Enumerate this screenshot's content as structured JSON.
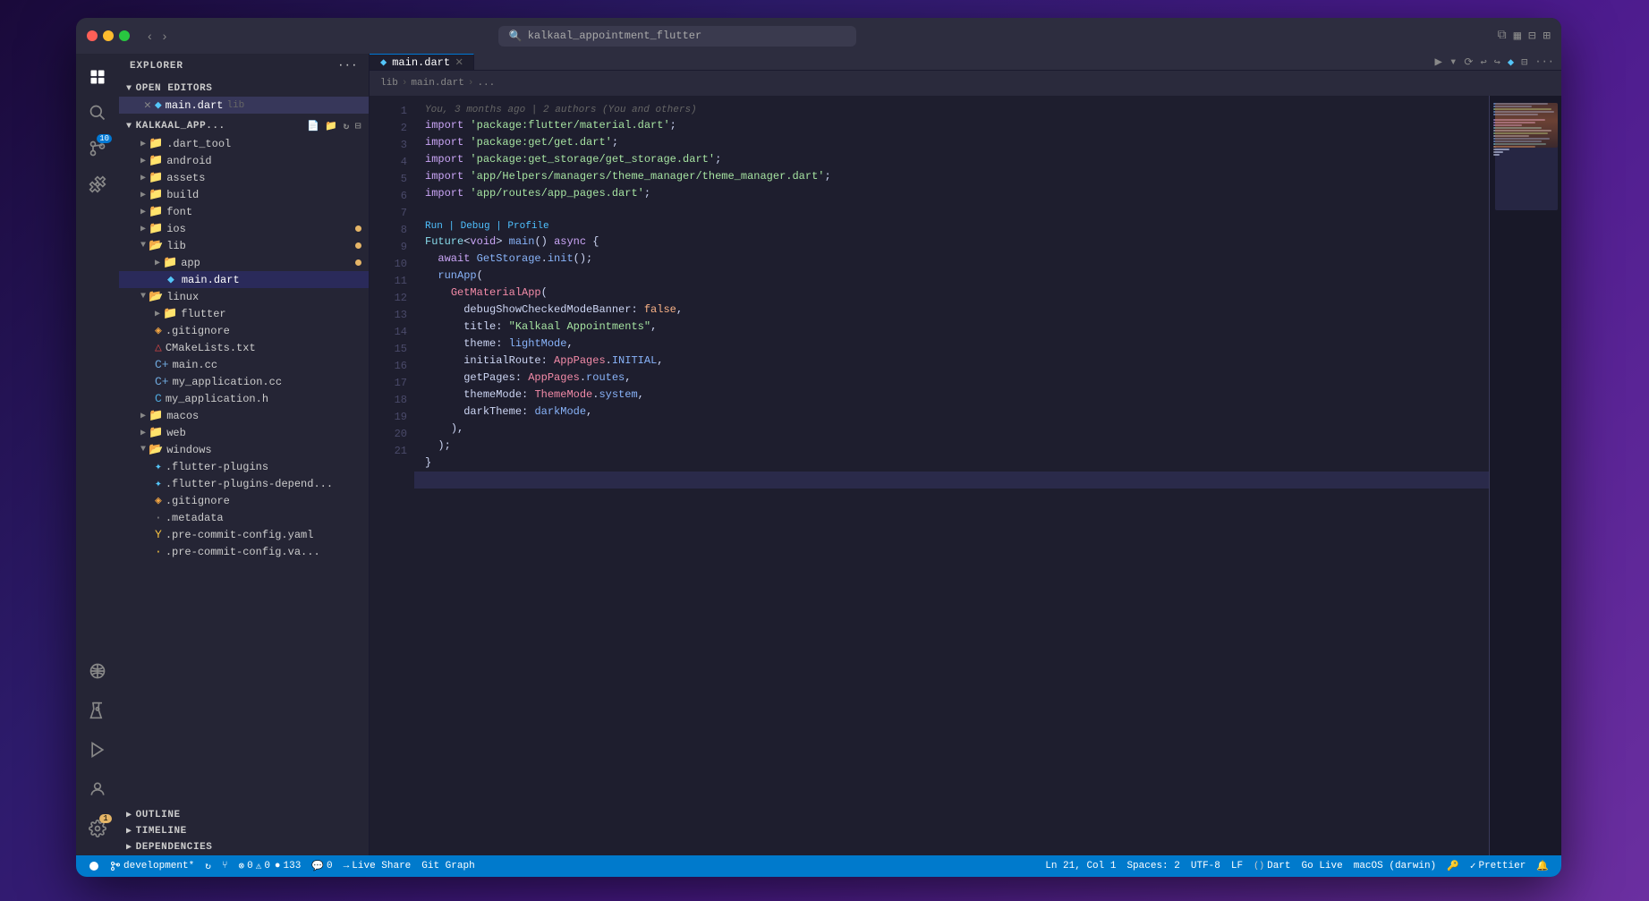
{
  "window": {
    "title": "kalkaal_appointment_flutter",
    "tab": "main.dart",
    "breadcrumb": [
      "lib",
      "main.dart",
      "..."
    ]
  },
  "editor": {
    "run_debug_label": "Run | Debug | Profile",
    "git_annotation": "You, 3 months ago | 2 authors (You and others)",
    "lines": [
      {
        "num": 1,
        "content": "import_flutter"
      },
      {
        "num": 2,
        "content": "import_get"
      },
      {
        "num": 3,
        "content": "import_get_storage"
      },
      {
        "num": 4,
        "content": "import_theme_manager"
      },
      {
        "num": 5,
        "content": "import_app_pages"
      },
      {
        "num": 6,
        "content": ""
      },
      {
        "num": 7,
        "content": "future_main"
      },
      {
        "num": 8,
        "content": "await_getstorage"
      },
      {
        "num": 9,
        "content": "run_app"
      },
      {
        "num": 10,
        "content": "get_material_app"
      },
      {
        "num": 11,
        "content": "debug_false"
      },
      {
        "num": 12,
        "content": "title"
      },
      {
        "num": 13,
        "content": "theme"
      },
      {
        "num": 14,
        "content": "initial_route"
      },
      {
        "num": 15,
        "content": "get_pages"
      },
      {
        "num": 16,
        "content": "theme_mode"
      },
      {
        "num": 17,
        "content": "dark_theme"
      },
      {
        "num": 18,
        "content": "close1"
      },
      {
        "num": 19,
        "content": "close2"
      },
      {
        "num": 20,
        "content": "close3"
      },
      {
        "num": 21,
        "content": ""
      }
    ]
  },
  "sidebar": {
    "explorer_label": "EXPLORER",
    "open_editors_label": "OPEN EDITORS",
    "project_label": "KALKAAL_APP...",
    "outline_label": "OUTLINE",
    "timeline_label": "TIMELINE",
    "dependencies_label": "DEPENDENCIES",
    "open_editor_item": "main.dart",
    "open_editor_path": "lib",
    "folders": [
      {
        "name": ".dart_tool",
        "type": "folder",
        "indent": 1
      },
      {
        "name": "android",
        "type": "folder",
        "indent": 1
      },
      {
        "name": "assets",
        "type": "folder",
        "indent": 1
      },
      {
        "name": "build",
        "type": "folder",
        "indent": 1
      },
      {
        "name": "font",
        "type": "folder",
        "indent": 1
      },
      {
        "name": "ios",
        "type": "folder",
        "indent": 1,
        "dot": "yellow"
      },
      {
        "name": "lib",
        "type": "folder",
        "indent": 1,
        "expanded": true,
        "dot": "yellow"
      },
      {
        "name": "app",
        "type": "folder",
        "indent": 2,
        "dot": "yellow"
      },
      {
        "name": "main.dart",
        "type": "dart",
        "indent": 3,
        "active": true
      },
      {
        "name": "linux",
        "type": "folder",
        "indent": 1,
        "expanded": true
      },
      {
        "name": "flutter",
        "type": "folder",
        "indent": 2
      },
      {
        "name": ".gitignore",
        "type": "gitignore",
        "indent": 2
      },
      {
        "name": "CMakeLists.txt",
        "type": "cmake",
        "indent": 2
      },
      {
        "name": "main.cc",
        "type": "cpp",
        "indent": 2
      },
      {
        "name": "my_application.cc",
        "type": "cpp",
        "indent": 2
      },
      {
        "name": "my_application.h",
        "type": "h",
        "indent": 2
      },
      {
        "name": "macos",
        "type": "folder",
        "indent": 1
      },
      {
        "name": "web",
        "type": "folder",
        "indent": 1
      },
      {
        "name": "windows",
        "type": "folder",
        "indent": 1,
        "expanded": true
      },
      {
        "name": ".flutter-plugins",
        "type": "flutter",
        "indent": 2
      },
      {
        "name": ".flutter-plugins-depend...",
        "type": "flutter",
        "indent": 2
      },
      {
        "name": ".gitignore",
        "type": "gitignore",
        "indent": 2
      },
      {
        "name": ".metadata",
        "type": "meta",
        "indent": 2
      },
      {
        "name": ".pre-commit-config.yaml",
        "type": "yaml",
        "indent": 2
      },
      {
        "name": ".pre-commit-config.va...",
        "type": "yaml",
        "indent": 2
      }
    ]
  },
  "statusbar": {
    "branch": "development*",
    "sync_icon": "↻",
    "errors": "0",
    "warnings": "0",
    "info": "133",
    "hints": "0",
    "live_share": "Live Share",
    "git_graph": "Git Graph",
    "position": "Ln 21, Col 1",
    "spaces": "Spaces: 2",
    "encoding": "UTF-8",
    "line_ending": "LF",
    "language": "Dart",
    "go_live": "Go Live",
    "macos": "macOS (darwin)",
    "prettier": "Prettier",
    "bell_icon": "🔔"
  },
  "activity_icons": [
    {
      "name": "files",
      "symbol": "⧉",
      "active": true
    },
    {
      "name": "search",
      "symbol": "🔍"
    },
    {
      "name": "git",
      "symbol": "⑂",
      "badge": "10"
    },
    {
      "name": "extensions",
      "symbol": "⚙"
    },
    {
      "name": "remote",
      "symbol": "◎"
    },
    {
      "name": "test",
      "symbol": "⚗"
    },
    {
      "name": "debug",
      "symbol": "▶"
    }
  ],
  "colors": {
    "bg": "#1e1e2e",
    "sidebar_bg": "#252535",
    "status_bar": "#007acc",
    "active_tab_border": "#0078d4",
    "accent": "#cba6f7"
  }
}
